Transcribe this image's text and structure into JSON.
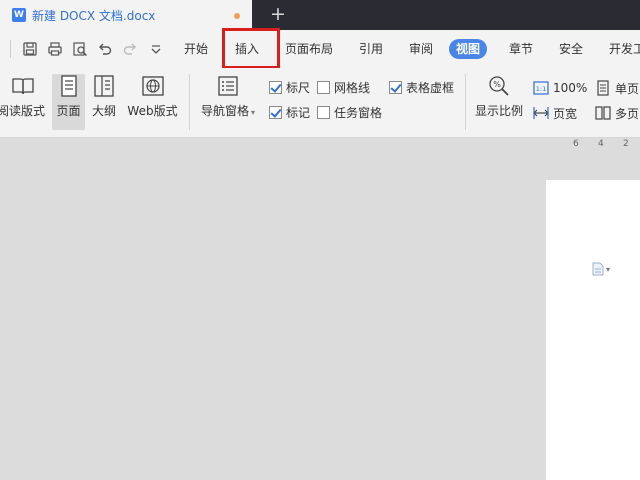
{
  "tab": {
    "icon_letter": "W",
    "title": "新建 DOCX 文档.docx",
    "new_tab_symbol": "+"
  },
  "menu": {
    "items": [
      "开始",
      "插入",
      "页面布局",
      "引用",
      "审阅",
      "视图",
      "章节",
      "安全",
      "开发工"
    ],
    "active": "视图",
    "highlighted": "插入"
  },
  "ribbon": {
    "read_mode": "阅读版式",
    "page_view": "页面",
    "outline": "大纲",
    "web_layout": "Web版式",
    "nav_pane": "导航窗格",
    "checks": {
      "ruler": {
        "label": "标尺",
        "checked": true
      },
      "gridlines": {
        "label": "网格线",
        "checked": false
      },
      "table_gridlines": {
        "label": "表格虚框",
        "checked": true
      },
      "marks": {
        "label": "标记",
        "checked": true
      },
      "task_pane": {
        "label": "任务窗格",
        "checked": false
      }
    },
    "zoom_ratio": "显示比例",
    "zoom_100": "100%",
    "page_width": "页宽",
    "single_page": "单页",
    "multi_page": "多页"
  },
  "ruler": {
    "ticks": [
      "6",
      "4",
      "2"
    ]
  },
  "colors": {
    "accent": "#4a86e8",
    "highlight": "#d91e1e",
    "tab_bar": "#2b2b33"
  }
}
